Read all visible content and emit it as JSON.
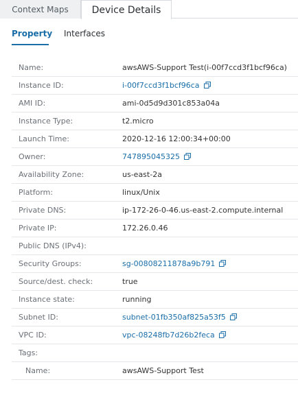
{
  "tabs": {
    "context_maps": "Context Maps",
    "device_details": "Device Details"
  },
  "subtabs": {
    "property": "Property",
    "interfaces": "Interfaces"
  },
  "colors": {
    "link": "#1a6ea8",
    "label": "#6a7077",
    "border": "#e4e6e9"
  },
  "properties": {
    "name": {
      "key": "Name:",
      "value": "awsAWS-Support Test(i-00f7ccd3f1bcf96ca)"
    },
    "instance_id": {
      "key": "Instance ID:",
      "value": "i-00f7ccd3f1bcf96ca",
      "copy_icon": "copy-icon"
    },
    "ami_id": {
      "key": "AMI ID:",
      "value": "ami-0d5d9d301c853a04a"
    },
    "instance_type": {
      "key": "Instance Type:",
      "value": "t2.micro"
    },
    "launch_time": {
      "key": "Launch Time:",
      "value": "2020-12-16 12:00:34+00:00"
    },
    "owner": {
      "key": "Owner:",
      "value": "747895045325",
      "copy_icon": "copy-icon"
    },
    "availability_zone": {
      "key": "Availability Zone:",
      "value": "us-east-2a"
    },
    "platform": {
      "key": "Platform:",
      "value": "linux/Unix"
    },
    "private_dns": {
      "key": "Private DNS:",
      "value": "ip-172-26-0-46.us-east-2.compute.internal"
    },
    "private_ip": {
      "key": "Private IP:",
      "value": "172.26.0.46"
    },
    "public_dns": {
      "key": "Public DNS (IPv4):",
      "value": ""
    },
    "security_groups": {
      "key": "Security Groups:",
      "value": "sg-00808211878a9b791",
      "copy_icon": "copy-icon"
    },
    "source_dest_check": {
      "key": "Source/dest. check:",
      "value": "true"
    },
    "instance_state": {
      "key": "Instance state:",
      "value": "running"
    },
    "subnet_id": {
      "key": "Subnet ID:",
      "value": "subnet-01fb350af825a53f5",
      "copy_icon": "copy-icon"
    },
    "vpc_id": {
      "key": "VPC ID:",
      "value": "vpc-08248fb7d26b2feca",
      "copy_icon": "copy-icon"
    },
    "tags": {
      "key": "Tags:",
      "value": ""
    },
    "tag_name": {
      "key": "Name:",
      "value": "awsAWS-Support Test"
    }
  }
}
